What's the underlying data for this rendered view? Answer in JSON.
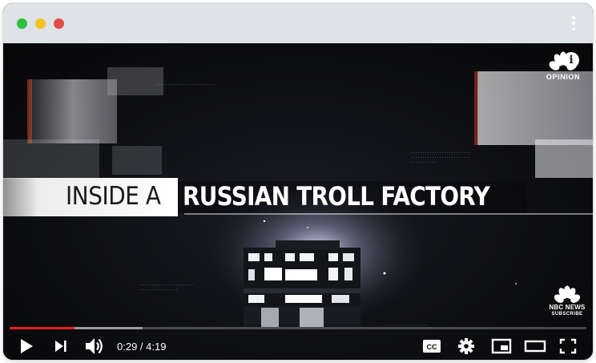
{
  "window": {
    "traffic_lights": [
      "green",
      "yellow",
      "red"
    ],
    "menu_icon": "kebab-menu-icon"
  },
  "video": {
    "headline_light": "INSIDE A",
    "headline_bold": "RUSSIAN TROLL FACTORY",
    "opinion_badge": {
      "label": "OPINION",
      "icon": "nbc-peacock-icon"
    },
    "info_icon": {
      "glyph": "i",
      "name": "info-icon"
    },
    "nbc_badge": {
      "line1": "NBC NEWS",
      "line2": "SUBSCRIBE",
      "icon": "nbc-peacock-icon"
    }
  },
  "player": {
    "current_time": "0:29",
    "duration": "4:19",
    "time_display": "0:29 / 4:19",
    "played_fraction": 0.112,
    "buffered_fraction": 0.23,
    "accent_color": "#e61e1e",
    "controls": {
      "play": "play-icon",
      "next": "next-icon",
      "volume": "volume-icon",
      "captions": "CC",
      "settings": "gear-icon",
      "miniplayer": "miniplayer-icon",
      "theater": "theater-mode-icon",
      "fullscreen": "fullscreen-icon"
    }
  }
}
